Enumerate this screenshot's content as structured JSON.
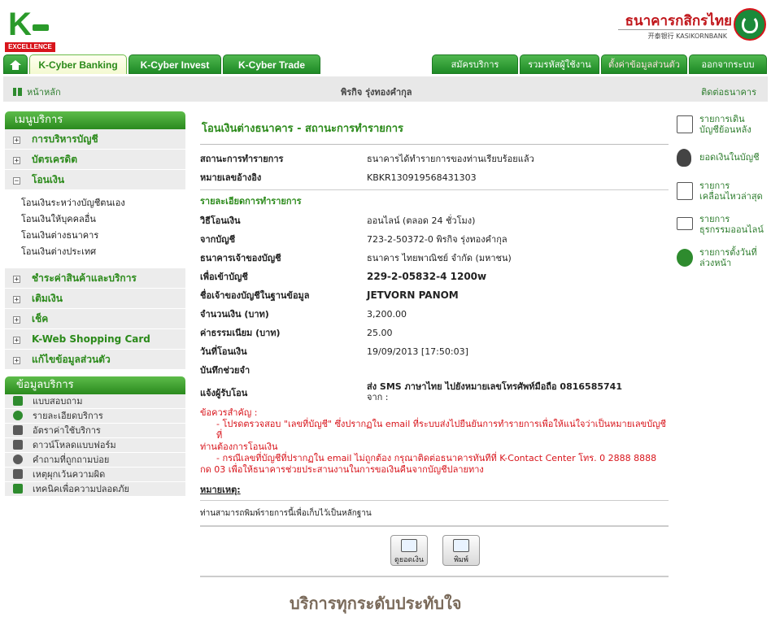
{
  "header": {
    "logo_letter": "K",
    "logo_tag": "EXCELLENCE",
    "bank_name": "ธนาคารกสิกรไทย",
    "bank_sub": "开泰银行 KASIKORNBANK"
  },
  "nav": {
    "tabs": [
      "K-Cyber Banking",
      "K-Cyber Invest",
      "K-Cyber Trade"
    ],
    "right_tabs": [
      "สมัครบริการ",
      "รวมรหัสผู้ใช้งาน",
      "ตั้งค่าข้อมูลส่วนตัว",
      "ออกจากระบบ"
    ]
  },
  "subbar": {
    "home": "หน้าหลัก",
    "user": "พิรกิจ รุ่งทองคำกุล",
    "contact": "ติดต่อธนาคาร"
  },
  "sidebar": {
    "menu_title": "เมนูบริการ",
    "items_top": [
      "การบริหารบัญชี",
      "บัตรเครดิต",
      "โอนเงิน"
    ],
    "transfer_sub": [
      "โอนเงินระหว่างบัญชีตนเอง",
      "โอนเงินให้บุคคลอื่น",
      "โอนเงินต่างธนาคาร",
      "โอนเงินต่างประเทศ"
    ],
    "items_bottom": [
      "ชำระค่าสินค้าและบริการ",
      "เติมเงิน",
      "เช็ค",
      "K-Web Shopping Card",
      "แก้ไขข้อมูลส่วนตัว"
    ],
    "info_title": "ข้อมูลบริการ",
    "info_items": [
      "แบบสอบถาม",
      "รายละเอียดบริการ",
      "อัตราค่าใช้บริการ",
      "ดาวน์โหลดแบบฟอร์ม",
      "คำถามที่ถูกถามบ่อย",
      "เหตุผุกเว้นความผิด",
      "เทคนิคเพื่อความปลอดภัย"
    ]
  },
  "main": {
    "title": "โอนเงินต่างธนาคาร - สถานะการทำรายการ",
    "status_label": "สถานะการทำรายการ",
    "status_value": "ธนาคารได้ทำรายการของท่านเรียบร้อยแล้ว",
    "ref_label": "หมายเลขอ้างอิง",
    "ref_value": "KBKR130919568431303",
    "detail_title": "รายละเอียดการทำรายการ",
    "details": [
      {
        "label": "วิธีโอนเงิน",
        "value": "ออนไลน์ (ตลอด 24 ชั่วโมง)"
      },
      {
        "label": "จากบัญชี",
        "value": "723-2-50372-0 พิรกิจ รุ่งทองคำกุล"
      },
      {
        "label": "ธนาคารเจ้าของบัญชี",
        "value": "ธนาคาร ไทยพาณิชย์ จำกัด (มหาชน)"
      },
      {
        "label": "เพื่อเข้าบัญชี",
        "value": "229-2-05832-4 1200w"
      },
      {
        "label": "ชื่อเจ้าของบัญชีในฐานข้อมูล",
        "value": "JETVORN PANOM"
      },
      {
        "label": "จำนวนเงิน (บาท)",
        "value": "3,200.00"
      },
      {
        "label": "ค่าธรรมเนียม (บาท)",
        "value": "25.00"
      },
      {
        "label": "วันที่โอนเงิน",
        "value": "19/09/2013 [17:50:03]"
      },
      {
        "label": "บันทึกช่วยจำ",
        "value": ""
      }
    ],
    "notify_label": "แจ้งผู้รับโอน",
    "notify_value": "ส่ง SMS ภาษาไทย ไปยังหมายเลขโทรศัพท์มือถือ 0816585741",
    "notify_value2": "จาก :",
    "warn_title": "ข้อควรสำคัญ :",
    "warn_1a": "- โปรดตรวจสอบ \"เลขที่บัญชี\" ซึ่งปรากฏใน email ที่ระบบส่งไปยืนยันการทำรายการเพื่อให้แน่ใจว่าเป็นหมายเลขบัญชีที่",
    "warn_1b": "ท่านต้องการโอนเงิน",
    "warn_2a": "- กรณีเลขที่บัญชีที่ปรากฏใน email ไม่ถูกต้อง กรุณาติดต่อธนาคารทันทีที่ K-Contact Center โทร. 0 2888 8888",
    "warn_2b": "กด 03 เพื่อให้ธนาคารช่วยประสานงานในการขอเงินคืนจากบัญชีปลายทาง",
    "note_title": "หมายเหตุ:",
    "note_text": "ท่านสามารถพิมพ์รายการนี้เพื่อเก็บไว้เป็นหลักฐาน",
    "btn_balance": "ดูยอดเงิน",
    "btn_print": "พิมพ์",
    "slogan": "บริการทุกระดับประทับใจ"
  },
  "rightcol": [
    {
      "l1": "รายการเดิน",
      "l2": "บัญชีย้อนหลัง"
    },
    {
      "l1": "ยอดเงินในบัญชี",
      "l2": ""
    },
    {
      "l1": "รายการ",
      "l2": "เคลื่อนไหวล่าสุด"
    },
    {
      "l1": "รายการ",
      "l2": "ธุรกรรมออนไลน์"
    },
    {
      "l1": "รายการตั้งวันที่",
      "l2": "ล่วงหน้า"
    }
  ]
}
